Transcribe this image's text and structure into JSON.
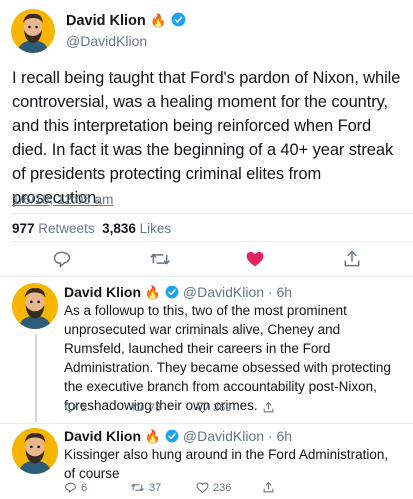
{
  "main_tweet": {
    "author_name": "David Klion",
    "emoji": "🔥",
    "handle": "@DavidKlion",
    "text": "I recall being taught that Ford's pardon of Nixon, while controversial, was a healing moment for the country, and this interpretation being reinforced when Ford died. In fact it was the beginning of a 40+ year streak of presidents protecting criminal elites from prosecution.",
    "timestamp": "1/6/18, 12:05 am",
    "retweets_count": "977",
    "retweets_label": "Retweets",
    "likes_count": "3,836",
    "likes_label": "Likes"
  },
  "replies": [
    {
      "author_name": "David Klion",
      "emoji": "🔥",
      "handle_time": "@DavidKlion · 6h",
      "text": "As a followup to this, two of the most prominent unprosecuted war criminals alive, Cheney and Rumsfeld, launched their careers in the Ford Administration. They became obsessed with protecting the executive branch from accountability post-Nixon, foreshadowing their own crimes.",
      "reply_count": "2",
      "retweet_count": "78",
      "like_count": "369"
    },
    {
      "author_name": "David Klion",
      "emoji": "🔥",
      "handle_time": "@DavidKlion · 6h",
      "text": "Kissinger also hung around in the Ford Administration, of course",
      "reply_count": "6",
      "retweet_count": "37",
      "like_count": "236"
    }
  ],
  "colors": {
    "verified": "#1da1f2",
    "liked": "#e0245e",
    "muted": "#657786",
    "avatar_bg": "#f7b500"
  }
}
